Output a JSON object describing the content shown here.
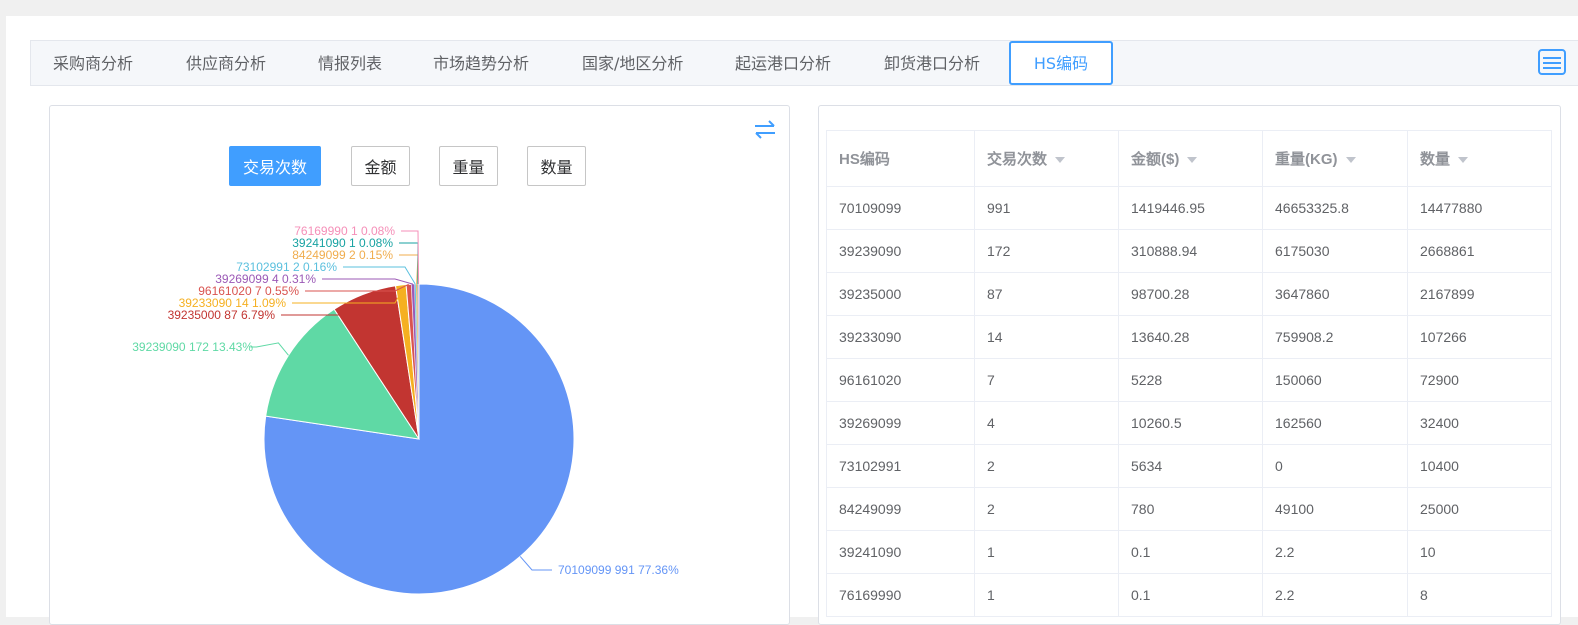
{
  "tabs": [
    {
      "label": "采购商分析",
      "active": false
    },
    {
      "label": "供应商分析",
      "active": false
    },
    {
      "label": "情报列表",
      "active": false
    },
    {
      "label": "市场趋势分析",
      "active": false
    },
    {
      "label": "国家/地区分析",
      "active": false
    },
    {
      "label": "起运港口分析",
      "active": false
    },
    {
      "label": "卸货港口分析",
      "active": false
    },
    {
      "label": "HS编码",
      "active": true
    }
  ],
  "tab_menu_icon": "menu-icon",
  "swap_icon": "swap-icon",
  "metric_buttons": [
    {
      "label": "交易次数",
      "active": true
    },
    {
      "label": "金额",
      "active": false
    },
    {
      "label": "重量",
      "active": false
    },
    {
      "label": "数量",
      "active": false
    }
  ],
  "chart_data": {
    "type": "pie",
    "slices": [
      {
        "label": "70109099",
        "count": 991,
        "pct": "77.36%",
        "color": "#6495f6"
      },
      {
        "label": "39239090",
        "count": 172,
        "pct": "13.43%",
        "color": "#5fd9a5"
      },
      {
        "label": "39235000",
        "count": 87,
        "pct": "6.79%",
        "color": "#c23531"
      },
      {
        "label": "39233090",
        "count": 14,
        "pct": "1.09%",
        "color": "#f5b021"
      },
      {
        "label": "96161020",
        "count": 7,
        "pct": "0.55%",
        "color": "#d9534f"
      },
      {
        "label": "39269099",
        "count": 4,
        "pct": "0.31%",
        "color": "#9b59b6"
      },
      {
        "label": "73102991",
        "count": 2,
        "pct": "0.16%",
        "color": "#5bc0de"
      },
      {
        "label": "84249099",
        "count": 2,
        "pct": "0.15%",
        "color": "#f0ad4e"
      },
      {
        "label": "39241090",
        "count": 1,
        "pct": "0.08%",
        "color": "#17a2a2"
      },
      {
        "label": "76169990",
        "count": 1,
        "pct": "0.08%",
        "color": "#f58fb8"
      }
    ]
  },
  "table": {
    "columns": [
      {
        "label": "HS编码",
        "sortable": false
      },
      {
        "label": "交易次数",
        "sortable": true
      },
      {
        "label": "金额($)",
        "sortable": true
      },
      {
        "label": "重量(KG)",
        "sortable": true
      },
      {
        "label": "数量",
        "sortable": true
      }
    ],
    "rows": [
      [
        "70109099",
        "991",
        "1419446.95",
        "46653325.8",
        "14477880"
      ],
      [
        "39239090",
        "172",
        "310888.94",
        "6175030",
        "2668861"
      ],
      [
        "39235000",
        "87",
        "98700.28",
        "3647860",
        "2167899"
      ],
      [
        "39233090",
        "14",
        "13640.28",
        "759908.2",
        "107266"
      ],
      [
        "96161020",
        "7",
        "5228",
        "150060",
        "72900"
      ],
      [
        "39269099",
        "4",
        "10260.5",
        "162560",
        "32400"
      ],
      [
        "73102991",
        "2",
        "5634",
        "0",
        "10400"
      ],
      [
        "84249099",
        "2",
        "780",
        "49100",
        "25000"
      ],
      [
        "39241090",
        "1",
        "0.1",
        "2.2",
        "10"
      ],
      [
        "76169990",
        "1",
        "0.1",
        "2.2",
        "8"
      ]
    ]
  }
}
